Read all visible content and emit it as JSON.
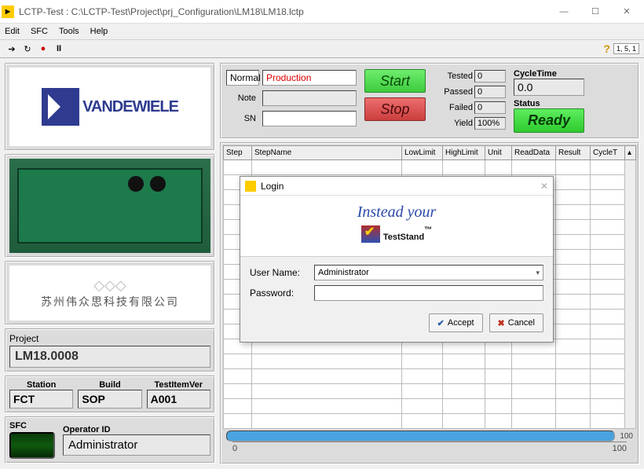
{
  "window": {
    "title": "LCTP-Test : C:\\LCTP-Test\\Project\\prj_Configuration\\LM18\\LM18.lctp"
  },
  "menu": {
    "edit": "Edit",
    "sfc": "SFC",
    "tools": "Tools",
    "help": "Help"
  },
  "brand": {
    "name": "VANDEWIELE"
  },
  "chinese": {
    "company": "苏州伟众思科技有限公司"
  },
  "project": {
    "label": "Project",
    "value": "LM18.0008"
  },
  "station": {
    "lbl": "Station",
    "val": "FCT"
  },
  "build": {
    "lbl": "Build",
    "val": "SOP"
  },
  "testitem": {
    "lbl": "TestItemVer",
    "val": "A001"
  },
  "sfc": {
    "lbl": "SFC",
    "op_lbl": "Operator ID",
    "op_val": "Administrator"
  },
  "controls": {
    "mode": "Normal",
    "phase": "Production",
    "note_lbl": "Note",
    "note": "",
    "sn_lbl": "SN",
    "sn": "",
    "start": "Start",
    "stop": "Stop"
  },
  "stats": {
    "tested_lbl": "Tested",
    "tested": "0",
    "passed_lbl": "Passed",
    "passed": "0",
    "failed_lbl": "Failed",
    "failed": "0",
    "yield_lbl": "Yield",
    "yield": "100%"
  },
  "cycle": {
    "lbl": "CycleTime",
    "val": "0.0",
    "status_lbl": "Status",
    "status": "Ready"
  },
  "table": {
    "cols": {
      "step": "Step",
      "stepname": "StepName",
      "low": "LowLimit",
      "high": "HighLimit",
      "unit": "Unit",
      "read": "ReadData",
      "result": "Result",
      "cyclet": "CycleT"
    }
  },
  "progress": {
    "end": "100",
    "scale_min": "0",
    "scale_max": "100"
  },
  "login": {
    "title": "Login",
    "banner1": "Instead your",
    "banner2": "TestStand",
    "tm": "™",
    "user_lbl": "User Name:",
    "user_val": "Administrator",
    "pass_lbl": "Password:",
    "accept": "Accept",
    "cancel": "Cancel"
  }
}
